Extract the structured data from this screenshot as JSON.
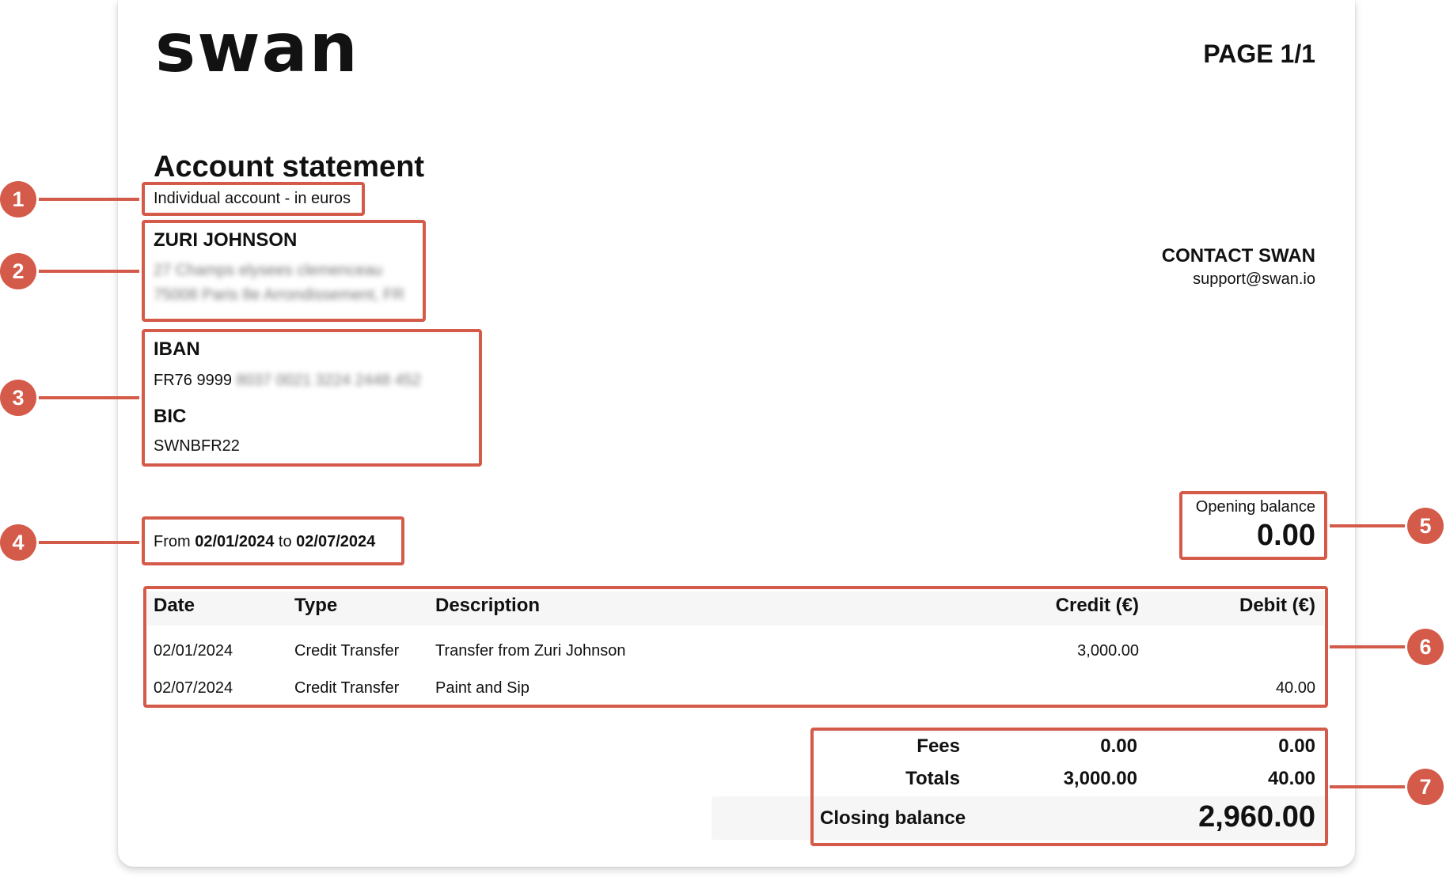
{
  "logo": {
    "text": "swan"
  },
  "page": {
    "label": "PAGE 1/1"
  },
  "statement": {
    "title": "Account statement",
    "account_type": "Individual account - in euros"
  },
  "holder": {
    "name": "ZURI JOHNSON",
    "address_line1": "27 Champs elysees clemenceau",
    "address_line2": "75008 Paris 8e Arrondissement, FR"
  },
  "bank": {
    "iban_label": "IBAN",
    "iban_visible": "FR76 9999",
    "iban_hidden": "8037 0021 3224 2448 452",
    "bic_label": "BIC",
    "bic_value": "SWNBFR22"
  },
  "contact": {
    "title": "CONTACT SWAN",
    "email": "support@swan.io"
  },
  "period": {
    "from_label": "From",
    "from_date": "02/01/2024",
    "to_label": "to",
    "to_date": "02/07/2024"
  },
  "opening_balance": {
    "label": "Opening balance",
    "value": "0.00"
  },
  "table": {
    "headers": {
      "date": "Date",
      "type": "Type",
      "description": "Description",
      "credit": "Credit (€)",
      "debit": "Debit (€)"
    },
    "rows": [
      {
        "date": "02/01/2024",
        "type": "Credit Transfer",
        "description": "Transfer from Zuri Johnson",
        "credit": "3,000.00",
        "debit": ""
      },
      {
        "date": "02/07/2024",
        "type": "Credit Transfer",
        "description": "Paint and Sip",
        "credit": "",
        "debit": "40.00"
      }
    ]
  },
  "summary": {
    "fees_label": "Fees",
    "fees_credit": "0.00",
    "fees_debit": "0.00",
    "totals_label": "Totals",
    "totals_credit": "3,000.00",
    "totals_debit": "40.00",
    "closing_label": "Closing balance",
    "closing_value": "2,960.00"
  },
  "markers": [
    "1",
    "2",
    "3",
    "4",
    "5",
    "6",
    "7"
  ],
  "colors": {
    "highlight": "#d45a49",
    "text": "#111111",
    "table_header_bg": "#f6f6f7"
  }
}
